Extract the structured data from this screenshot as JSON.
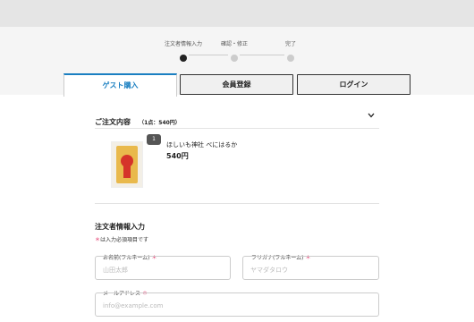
{
  "stepper": {
    "steps": [
      {
        "label": "注文者情報入力",
        "active": true
      },
      {
        "label": "確認・修正",
        "active": false
      },
      {
        "label": "完了",
        "active": false
      }
    ]
  },
  "tabs": [
    {
      "label": "ゲスト購入",
      "active": true
    },
    {
      "label": "会員登録",
      "active": false
    },
    {
      "label": "ログイン",
      "active": false
    }
  ],
  "order": {
    "title": "ご注文内容",
    "count": "（1点：540円）",
    "item": {
      "quantity": "1",
      "name": "ほしいも神社 べにはるか",
      "price": "540円"
    }
  },
  "form": {
    "section_title": "注文者情報入力",
    "required_mark": "＊",
    "required_note": "は入力必須項目です",
    "name_label": "お名前(フルネーム)",
    "name_placeholder": "山田太郎",
    "kana_label": "フリガナ(フルネーム)",
    "kana_placeholder": "ヤマダタロウ",
    "email_label": "メールアドレス",
    "email_placeholder": "info@example.com"
  },
  "colors": {
    "accent": "#1a7fc1",
    "required": "#e0245e"
  }
}
